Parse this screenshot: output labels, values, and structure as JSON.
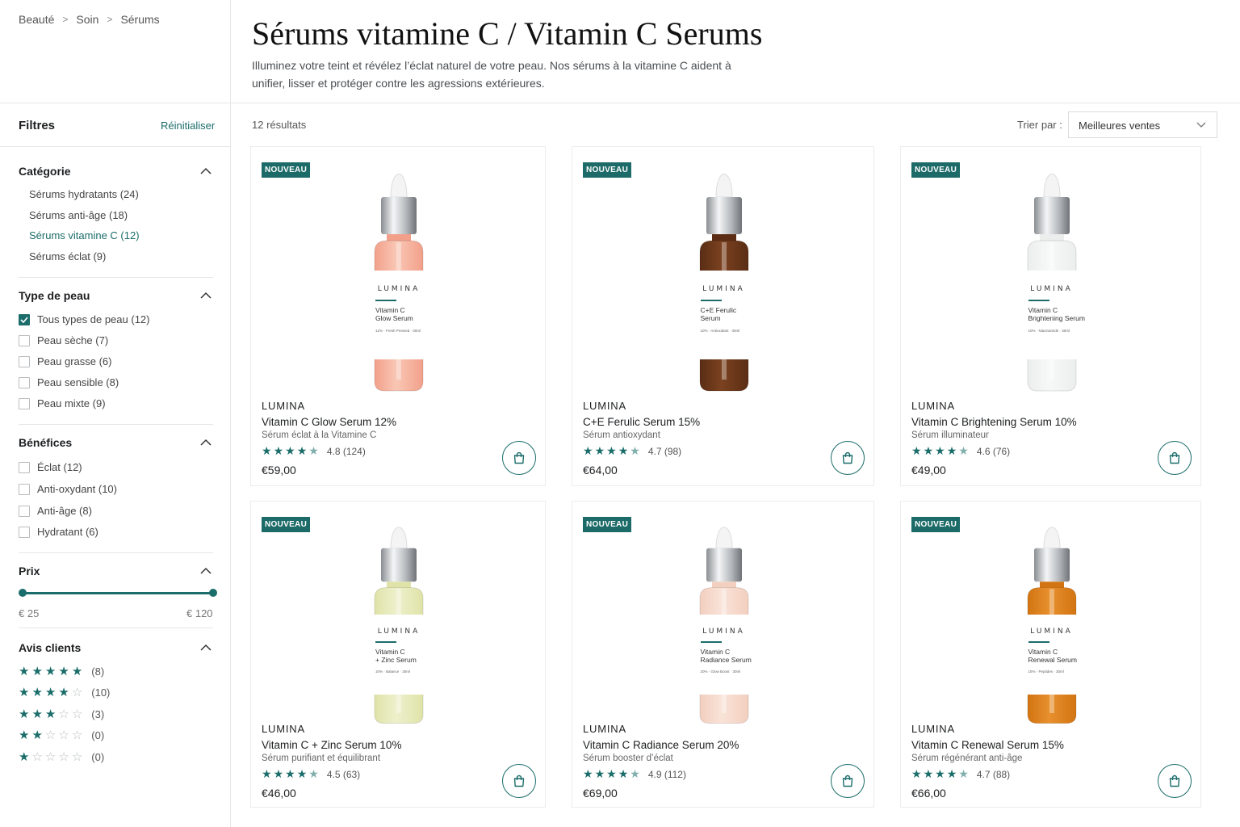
{
  "breadcrumb": [
    "Beauté",
    "Soin",
    "Sérums"
  ],
  "page": {
    "title": "Sérums vitamine C / Vitamin C Serums",
    "description": "Illuminez votre teint et révélez l’éclat naturel de votre peau. Nos sérums à la vitamine C aident à unifier, lisser et protéger contre les agressions extérieures."
  },
  "filters": {
    "title": "Filtres",
    "reset": "Réinitialiser",
    "category": {
      "title": "Catégorie",
      "items": [
        "Sérums hydratants (24)",
        "Sérums anti-âge (18)",
        "Sérums vitamine C (12)",
        "Sérums éclat (9)"
      ],
      "active_index": 2
    },
    "skin_type": {
      "title": "Type de peau",
      "items": [
        {
          "label": "Tous types de peau (12)",
          "checked": true
        },
        {
          "label": "Peau sèche (7)",
          "checked": false
        },
        {
          "label": "Peau grasse (6)",
          "checked": false
        },
        {
          "label": "Peau sensible (8)",
          "checked": false
        },
        {
          "label": "Peau mixte (9)",
          "checked": false
        }
      ]
    },
    "benefits": {
      "title": "Bénéfices",
      "items": [
        {
          "label": "Éclat (12)",
          "checked": false
        },
        {
          "label": "Anti-oxydant (10)",
          "checked": false
        },
        {
          "label": "Anti-âge (8)",
          "checked": false
        },
        {
          "label": "Hydratant (6)",
          "checked": false
        }
      ]
    },
    "price": {
      "title": "Prix",
      "min_label": "€ 25",
      "max_label": "€ 120",
      "min": 25,
      "max": 120
    },
    "reviews": {
      "title": "Avis clients",
      "rows": [
        {
          "stars": 5,
          "count": "(8)"
        },
        {
          "stars": 4,
          "count": "(10)"
        },
        {
          "stars": 3,
          "count": "(3)"
        },
        {
          "stars": 2,
          "count": "(0)"
        },
        {
          "stars": 1,
          "count": "(0)"
        }
      ]
    }
  },
  "toolbar": {
    "results": "12 résultats",
    "sort_label": "Trier par :",
    "sort_value": "Meilleures ventes"
  },
  "products": [
    {
      "badge": "NOUVEAU",
      "brand": "LUMINA",
      "name": "Vitamin C Glow Serum 12%",
      "subtitle": "Sérum éclat à la Vitamine C",
      "rating": 4.8,
      "rating_text": "4.8 (124)",
      "price": "€59,00",
      "label_brand": "LUMINA",
      "label_line1": "Vitamin C",
      "label_line2": "Glow Serum",
      "label_small": "12% · Fresh Pressed · 30ml",
      "liquid": "#f2a08a",
      "liquid2": "#f9c7b5"
    },
    {
      "badge": "NOUVEAU",
      "brand": "LUMINA",
      "name": "C+E Ferulic Serum 15%",
      "subtitle": "Sérum antioxydant",
      "rating": 4.7,
      "rating_text": "4.7 (98)",
      "price": "€64,00",
      "label_brand": "LUMINA",
      "label_line1": "C+E Ferulic",
      "label_line2": "Serum",
      "label_small": "10% · Antioxidant · 30ml",
      "liquid": "#5a2d14",
      "liquid2": "#7b4220"
    },
    {
      "badge": "NOUVEAU",
      "brand": "LUMINA",
      "name": "Vitamin C Brightening Serum 10%",
      "subtitle": "Sérum illuminateur",
      "rating": 4.6,
      "rating_text": "4.6 (76)",
      "price": "€49,00",
      "label_brand": "LUMINA",
      "label_line1": "Vitamin C",
      "label_line2": "Brightening Serum",
      "label_small": "10% · Niacinamide · 30ml",
      "liquid": "#eceeee",
      "liquid2": "#f7f8f8"
    },
    {
      "badge": "NOUVEAU",
      "brand": "LUMINA",
      "name": "Vitamin C + Zinc Serum 10%",
      "subtitle": "Sérum purifiant et équilibrant",
      "rating": 4.5,
      "rating_text": "4.5 (63)",
      "price": "€46,00",
      "label_brand": "LUMINA",
      "label_line1": "Vitamin C",
      "label_line2": "+ Zinc Serum",
      "label_small": "10% · Balance · 30ml",
      "liquid": "#dfe3a8",
      "liquid2": "#eef0cc"
    },
    {
      "badge": "NOUVEAU",
      "brand": "LUMINA",
      "name": "Vitamin C Radiance Serum 20%",
      "subtitle": "Sérum booster d’éclat",
      "rating": 4.9,
      "rating_text": "4.9 (112)",
      "price": "€69,00",
      "label_brand": "LUMINA",
      "label_line1": "Vitamin C",
      "label_line2": "Radiance Serum",
      "label_small": "20% · Glow Boost · 30ml",
      "liquid": "#f3cfbf",
      "liquid2": "#f9e3d8"
    },
    {
      "badge": "NOUVEAU",
      "brand": "LUMINA",
      "name": "Vitamin C Renewal Serum 15%",
      "subtitle": "Sérum régénérant anti-âge",
      "rating": 4.7,
      "rating_text": "4.7 (88)",
      "price": "€66,00",
      "label_brand": "LUMINA",
      "label_line1": "Vitamin C",
      "label_line2": "Renewal Serum",
      "label_small": "15% · Peptides · 30ml",
      "liquid": "#d27412",
      "liquid2": "#e8902e"
    }
  ],
  "colors": {
    "accent": "#1a6d6a",
    "badge": "#1d6b68"
  },
  "icons": {
    "cart": "shopping-bag-icon",
    "chevron": "chevron-up-icon",
    "sort": "chevron-down-icon"
  }
}
